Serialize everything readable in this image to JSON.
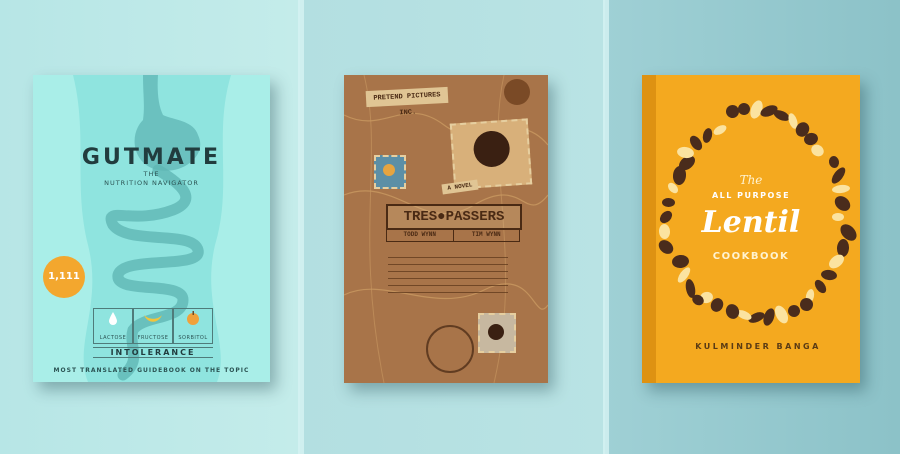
{
  "books": [
    {
      "title": "GUTMATE",
      "kicker": "THE",
      "subtitle": "NUTRITION NAVIGATOR",
      "seal": "1,111",
      "labels": [
        "LACTOSE",
        "FRUCTOSE",
        "SORBITOL"
      ],
      "category": "INTOLERANCE",
      "tagline": "MOST TRANSLATED GUIDEBOOK ON THE TOPIC",
      "colors": {
        "cover": "#8fe4df",
        "ink": "#213c3e",
        "seal": "#f3a72e"
      }
    },
    {
      "stamp_label": "PRETEND PICTURES INC.",
      "title": "TRES●PASSERS",
      "authors": [
        "TODD WYNN",
        "TIM WYNN"
      ],
      "tag": "A NOVEL",
      "colors": {
        "cover": "#a87449",
        "ink": "#4a2a14",
        "paper": "#e0c594"
      }
    },
    {
      "title_top": "The",
      "title_mid": "ALL PURPOSE",
      "title_main": "Lentil",
      "title_bottom": "COOKBOOK",
      "author": "KULMINDER BANGA",
      "colors": {
        "cover": "#f4a91f",
        "bean_dark": "#4a2c1c",
        "bean_light": "#fbe3a0"
      }
    }
  ]
}
